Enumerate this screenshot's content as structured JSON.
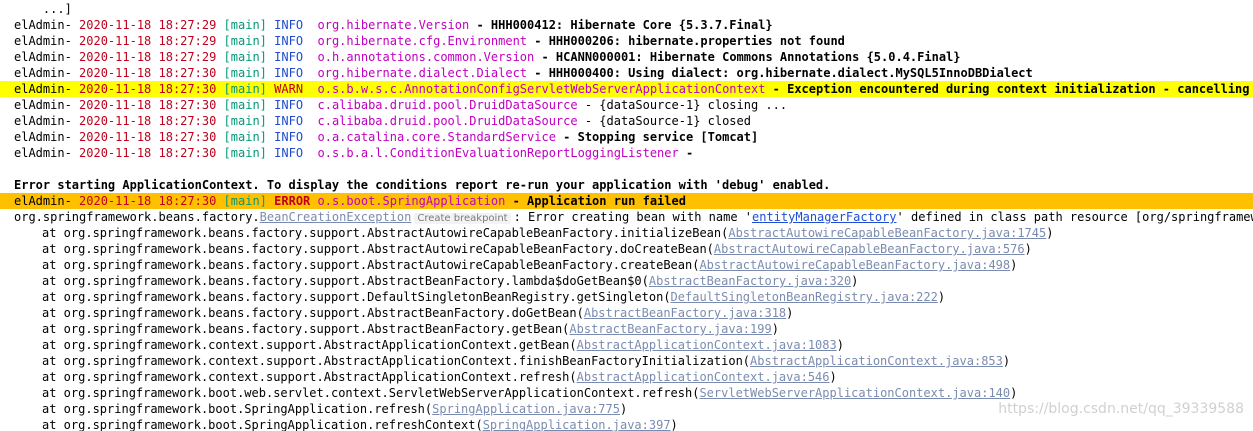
{
  "console": {
    "head": "...]",
    "logs": [
      {
        "app": "elAdmin-",
        "time": "2020-11-18 18:27:29",
        "thread": "[main]",
        "level": "INFO ",
        "logger": "org.hibernate.Version",
        "message": " - HHH000412: Hibernate Core {5.3.7.Final}"
      },
      {
        "app": "elAdmin-",
        "time": "2020-11-18 18:27:29",
        "thread": "[main]",
        "level": "INFO ",
        "logger": "org.hibernate.cfg.Environment",
        "message": " - HHH000206: hibernate.properties not found"
      },
      {
        "app": "elAdmin-",
        "time": "2020-11-18 18:27:29",
        "thread": "[main]",
        "level": "INFO ",
        "logger": "o.h.annotations.common.Version",
        "message": " - HCANN000001: Hibernate Commons Annotations {5.0.4.Final}"
      },
      {
        "app": "elAdmin-",
        "time": "2020-11-18 18:27:30",
        "thread": "[main]",
        "level": "INFO ",
        "logger": "org.hibernate.dialect.Dialect",
        "message": " - HHH000400: Using dialect: org.hibernate.dialect.MySQL5InnoDBDialect"
      },
      {
        "app": "elAdmin-",
        "time": "2020-11-18 18:27:30",
        "thread": "[main]",
        "level": "WARN ",
        "logger": "o.s.b.w.s.c.AnnotationConfigServletWebServerApplicationContext",
        "message": " - Exception encountered during context initialization - cancelling refresh"
      },
      {
        "app": "elAdmin-",
        "time": "2020-11-18 18:27:30",
        "thread": "[main]",
        "level": "INFO ",
        "logger": "c.alibaba.druid.pool.DruidDataSource",
        "message": " - {dataSource-1} closing ..."
      },
      {
        "app": "elAdmin-",
        "time": "2020-11-18 18:27:30",
        "thread": "[main]",
        "level": "INFO ",
        "logger": "c.alibaba.druid.pool.DruidDataSource",
        "message": " - {dataSource-1} closed"
      },
      {
        "app": "elAdmin-",
        "time": "2020-11-18 18:27:30",
        "thread": "[main]",
        "level": "INFO ",
        "logger": "o.a.catalina.core.StandardService",
        "message": " - Stopping service [Tomcat]"
      },
      {
        "app": "elAdmin-",
        "time": "2020-11-18 18:27:30",
        "thread": "[main]",
        "level": "INFO ",
        "logger": "o.s.b.a.l.ConditionEvaluationReportLoggingListener",
        "message": " -"
      }
    ],
    "error_notice": "Error starting ApplicationContext. To display the conditions report re-run your application with 'debug' enabled.",
    "error_log": {
      "app": "elAdmin-",
      "time": "2020-11-18 18:27:30",
      "thread": "[main]",
      "level": "ERROR",
      "logger": "o.s.boot.SpringApplication",
      "message": " - Application run failed"
    },
    "exception": {
      "package": "org.springframework.beans.factory.",
      "class_link": "BeanCreationException",
      "breakpoint_label": "Create breakpoint",
      "message_prefix": ": Error creating bean with name '",
      "bean_name": "entityManagerFactory",
      "message_suffix": "' defined in class path resource [org/springframework/boot/autoconfigure/orm/jpa/HibernateJpaConfiguration.class]"
    },
    "trace": [
      {
        "at": "at org.springframework.beans.factory.support.AbstractAutowireCapableBeanFactory.initializeBean(",
        "file": "AbstractAutowireCapableBeanFactory.java:1745",
        "end": ")"
      },
      {
        "at": "at org.springframework.beans.factory.support.AbstractAutowireCapableBeanFactory.doCreateBean(",
        "file": "AbstractAutowireCapableBeanFactory.java:576",
        "end": ")"
      },
      {
        "at": "at org.springframework.beans.factory.support.AbstractAutowireCapableBeanFactory.createBean(",
        "file": "AbstractAutowireCapableBeanFactory.java:498",
        "end": ")"
      },
      {
        "at": "at org.springframework.beans.factory.support.AbstractBeanFactory.lambda$doGetBean$0(",
        "file": "AbstractBeanFactory.java:320",
        "end": ")"
      },
      {
        "at": "at org.springframework.beans.factory.support.DefaultSingletonBeanRegistry.getSingleton(",
        "file": "DefaultSingletonBeanRegistry.java:222",
        "end": ")"
      },
      {
        "at": "at org.springframework.beans.factory.support.AbstractBeanFactory.doGetBean(",
        "file": "AbstractBeanFactory.java:318",
        "end": ")"
      },
      {
        "at": "at org.springframework.beans.factory.support.AbstractBeanFactory.getBean(",
        "file": "AbstractBeanFactory.java:199",
        "end": ")"
      },
      {
        "at": "at org.springframework.context.support.AbstractApplicationContext.getBean(",
        "file": "AbstractApplicationContext.java:1083",
        "end": ")"
      },
      {
        "at": "at org.springframework.context.support.AbstractApplicationContext.finishBeanFactoryInitialization(",
        "file": "AbstractApplicationContext.java:853",
        "end": ")"
      },
      {
        "at": "at org.springframework.context.support.AbstractApplicationContext.refresh(",
        "file": "AbstractApplicationContext.java:546",
        "end": ")"
      },
      {
        "at": "at org.springframework.boot.web.servlet.context.ServletWebServerApplicationContext.refresh(",
        "file": "ServletWebServerApplicationContext.java:140",
        "end": ")"
      },
      {
        "at": "at org.springframework.boot.SpringApplication.refresh(",
        "file": "SpringApplication.java:775",
        "end": ")"
      },
      {
        "at": "at org.springframework.boot.SpringApplication.refreshContext(",
        "file": "SpringApplication.java:397",
        "end": ")"
      }
    ]
  },
  "watermark": "https://blog.csdn.net/qq_39339588",
  "colors": {
    "timestamp": "#c0001c",
    "thread": "#009a78",
    "info": "#1f4dd6",
    "logger": "#c000c0",
    "warn_highlight": "#ffff00",
    "error_highlight": "#ffc000",
    "file_link": "#7b8bb0"
  }
}
